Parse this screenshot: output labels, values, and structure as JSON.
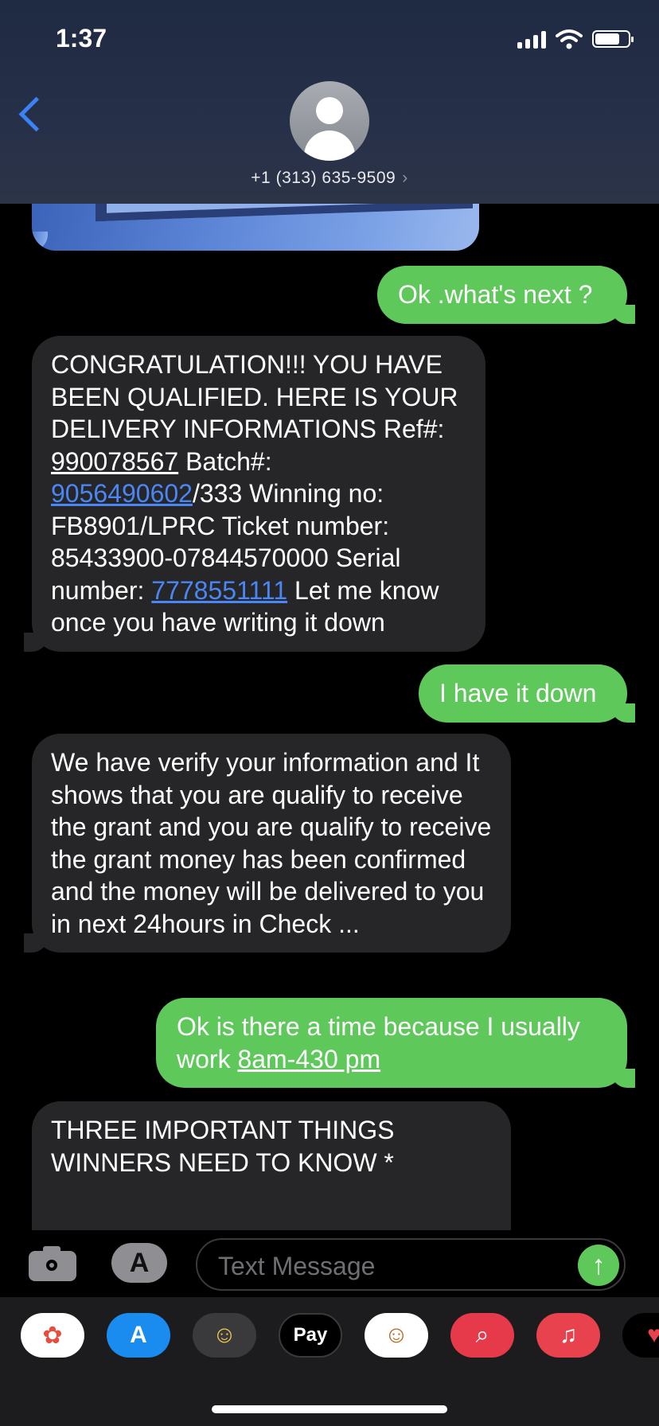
{
  "status_bar": {
    "time": "1:37"
  },
  "header": {
    "contact": "+1 (313) 635-9509",
    "chevron": "›"
  },
  "messages": [
    {
      "from": "me",
      "text": "Ok .what's next ?"
    },
    {
      "from": "them",
      "parts": [
        "CONGRATULATION!!! YOU HAVE BEEN QUALIFIED. HERE IS YOUR DELIVERY INFORMATIONS Ref#: ",
        "990078567",
        " Batch#: ",
        "9056490602",
        "/333 Winning no: FB8901/LPRC Ticket number: 85433900-07844570000 Serial number: ",
        "7778551111",
        " Let me know once you have writing it down"
      ]
    },
    {
      "from": "me",
      "text": "I have it down"
    },
    {
      "from": "them",
      "text": "We have verify your information and It shows that you are qualify to receive the grant and you are qualify to receive the grant money has been confirmed and the money will be delivered to you in next 24hours in Check ..."
    },
    {
      "from": "me",
      "parts": [
        "Ok is there a time because I usually work ",
        "8am-430 pm"
      ]
    },
    {
      "from": "them",
      "text": "THREE IMPORTANT THINGS WINNERS NEED TO KNOW *"
    }
  ],
  "composer": {
    "placeholder": "Text Message",
    "send_glyph": "↑",
    "appstore_glyph": "A"
  },
  "app_strip": [
    {
      "name": "photos",
      "glyph": "✿",
      "bg": "#ffffff",
      "fg": "#e84c3d"
    },
    {
      "name": "app-store",
      "glyph": "A",
      "bg": "#1a8cf0",
      "fg": "#ffffff"
    },
    {
      "name": "memoji-frame",
      "glyph": "☺",
      "bg": "#3a3a3c",
      "fg": "#f2c94c"
    },
    {
      "name": "apple-pay",
      "glyph": "Pay",
      "bg": "#000000",
      "fg": "#ffffff"
    },
    {
      "name": "memoji-stickers",
      "glyph": "☺",
      "bg": "#ffffff",
      "fg": "#b5651d"
    },
    {
      "name": "web-search",
      "glyph": "⌕",
      "bg": "#e63a4a",
      "fg": "#ffffff"
    },
    {
      "name": "music",
      "glyph": "♫",
      "bg": "#e8424e",
      "fg": "#ffffff"
    },
    {
      "name": "digital-touch",
      "glyph": "♥",
      "bg": "#000000",
      "fg": "#e8424e"
    }
  ]
}
